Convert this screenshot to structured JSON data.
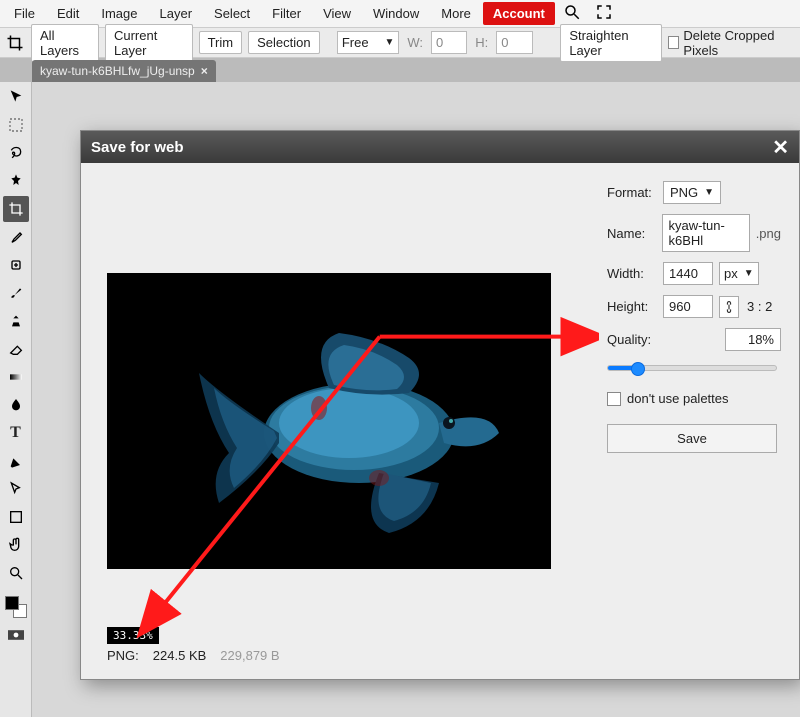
{
  "menubar": {
    "items": [
      "File",
      "Edit",
      "Image",
      "Layer",
      "Select",
      "Filter",
      "View",
      "Window",
      "More"
    ],
    "account": "Account"
  },
  "optbar": {
    "all_layers": "All Layers",
    "current_layer": "Current Layer",
    "trim": "Trim",
    "selection": "Selection",
    "ratio": "Free",
    "w_label": "W:",
    "w_val": "0",
    "h_label": "H:",
    "h_val": "0",
    "straighten": "Straighten Layer",
    "delete_cropped": "Delete Cropped Pixels"
  },
  "tab": {
    "name": "kyaw-tun-k6BHLfw_jUg-unsp"
  },
  "dialog": {
    "title": "Save for web",
    "format_label": "Format:",
    "format_val": "PNG",
    "name_label": "Name:",
    "name_val": "kyaw-tun-k6BHl",
    "name_ext": ".png",
    "width_label": "Width:",
    "width_val": "1440",
    "width_unit": "px",
    "height_label": "Height:",
    "height_val": "960",
    "aspect": "3 : 2",
    "quality_label": "Quality:",
    "quality_val": "18%",
    "palettes_label": "don't use palettes",
    "save": "Save",
    "zoom": "33.33%",
    "file_format": "PNG:",
    "file_size": "224.5 KB",
    "file_bytes": "229,879 B"
  }
}
